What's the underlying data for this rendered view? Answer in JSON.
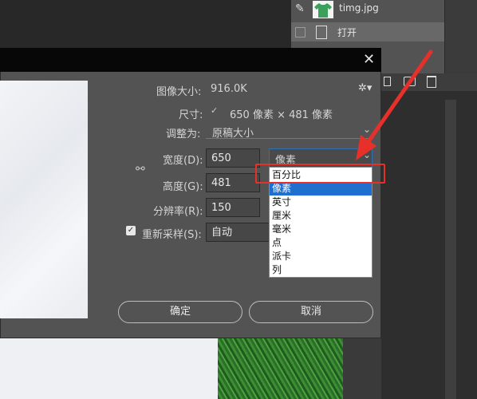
{
  "layers": {
    "item1": {
      "name": "timg.jpg"
    },
    "item2": {
      "name": "打开"
    }
  },
  "dialog": {
    "image_size_label": "图像大小:",
    "image_size_value": "916.0K",
    "dimensions_label": "尺寸:",
    "dimensions_value": "650 像素 × 481 像素",
    "fit_to_label": "调整为:",
    "fit_to_value": "原稿大小",
    "width_label": "宽度(D):",
    "width_value": "650",
    "height_label": "高度(G):",
    "height_value": "481",
    "resolution_label": "分辨率(R):",
    "resolution_value": "150",
    "resample_label": "重新采样(S):",
    "resample_value": "自动",
    "unit_value": "像素",
    "ok_label": "确定",
    "cancel_label": "取消"
  },
  "dropdown": {
    "options": [
      "百分比",
      "像素",
      "英寸",
      "厘米",
      "毫米",
      "点",
      "派卡",
      "列"
    ],
    "selected": "像素"
  },
  "colors": {
    "annotation": "#e8302b",
    "selection": "#1e6fd0"
  }
}
